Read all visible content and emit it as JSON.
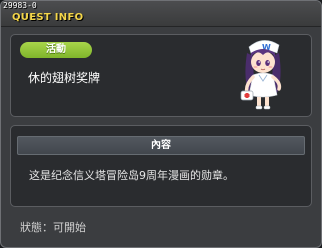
{
  "window": {
    "id": "29983-0",
    "title": "QUEST INFO"
  },
  "quest": {
    "category": "活動",
    "name": "休的翅树奖牌",
    "npc_icon": "nurse-girl-npc-portrait"
  },
  "content": {
    "header": "內容",
    "text": "这是纪念信义塔冒险岛9周年漫画的勋章。"
  },
  "status": {
    "label": "狀態",
    "value": "可開始",
    "text": "狀態：可開始"
  },
  "colors": {
    "title": "#f4d64a",
    "badge": "#8cc334",
    "panel": "#2a2c2f",
    "window": "#3b3d40"
  }
}
